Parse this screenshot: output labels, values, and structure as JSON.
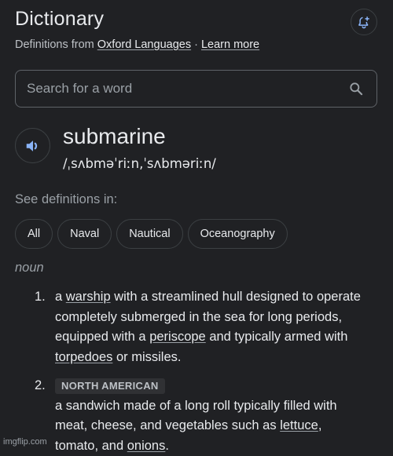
{
  "header": {
    "title": "Dictionary",
    "subtitle_prefix": "Definitions from ",
    "source_link": "Oxford Languages",
    "separator": " · ",
    "learn_more_link": "Learn more",
    "bell_icon": "bell-plus-icon"
  },
  "search": {
    "placeholder": "Search for a word",
    "value": "",
    "icon": "search-icon"
  },
  "entry": {
    "word": "submarine",
    "phonetic": "/ˌsʌbməˈriːn,ˈsʌbməriːn/",
    "audio_icon": "speaker-icon"
  },
  "filters": {
    "label": "See definitions in:",
    "chips": [
      {
        "label": "All"
      },
      {
        "label": "Naval"
      },
      {
        "label": "Nautical"
      },
      {
        "label": "Oceanography"
      }
    ]
  },
  "definitions": {
    "part_of_speech": "noun",
    "senses": [
      {
        "number": "1.",
        "parts": [
          {
            "text": "a "
          },
          {
            "link": "warship"
          },
          {
            "text": " with a streamlined hull designed to operate completely submerged in the sea for long periods, equipped with a "
          },
          {
            "link": "periscope"
          },
          {
            "text": " and typically armed with "
          },
          {
            "link": "torpedoes"
          },
          {
            "text": " or missiles."
          }
        ]
      },
      {
        "number": "2.",
        "label": "NORTH AMERICAN",
        "parts": [
          {
            "text": "a sandwich made of a long roll typically filled with meat, cheese, and vegetables such as "
          },
          {
            "link": "lettuce"
          },
          {
            "text": ", tomato, and "
          },
          {
            "link": "onions"
          },
          {
            "text": "."
          }
        ]
      }
    ]
  },
  "watermark": "imgflip.com",
  "colors": {
    "background": "#202124",
    "text_primary": "#e8eaed",
    "text_secondary": "#9aa0a6",
    "accent_icon": "#8ab4f8",
    "border": "#3c4043"
  }
}
